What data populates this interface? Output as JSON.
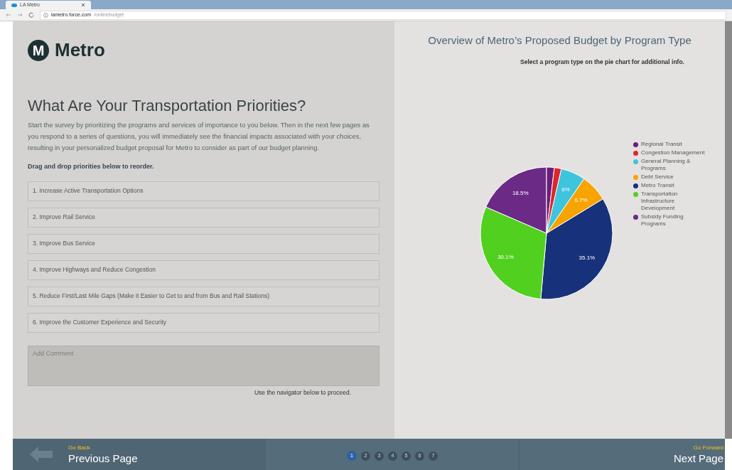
{
  "browser": {
    "tab_title": "LA Metro",
    "url_host": "lametro.force.com",
    "url_path": "/onlinebudget"
  },
  "logo": {
    "text": "Metro",
    "letter": "M"
  },
  "survey": {
    "title": "What Are Your Transportation Priorities?",
    "intro": "Start the survey by prioritizing the programs and services of importance to you below. Then in the next few pages as you respond to a series of questions, you will immediately see the financial impacts associated with your choices, resulting in your personalized budget proposal for Metro to consider as part of our budget planning.",
    "instruction": "Drag and drop priorities below to reorder.",
    "priorities": [
      "1. Increase Active Transportation Options",
      "2. Improve Rail Service",
      "3. Improve Bus Service",
      "4. Improve Highways and Reduce Congestion",
      "5. Reduce First/Last Mile Gaps (Make it Easier to Get to and from Bus and Rail Stations)",
      "6. Improve the Customer Experience and Security"
    ],
    "comment": {
      "placeholder": "Add Comment"
    },
    "navigator_hint": "Use the navigator below to proceed."
  },
  "overview": {
    "title": "Overview of Metro’s Proposed Budget by Program Type",
    "subtitle": "Select a program type on the pie chart for additional info.",
    "chart_data": {
      "type": "pie",
      "categories": [
        "Regional Transit",
        "Congestion Management",
        "General Planning & Programs",
        "Debt Service",
        "Metro Transit",
        "Transportation Infrastructure Development",
        "Subsidy Funding Programs"
      ],
      "series": [
        {
          "values": [
            1.9,
            1.7,
            6,
            6.7,
            35.1,
            30.1,
            18.5
          ]
        }
      ],
      "colors": [
        "#6a1f7a",
        "#e0242a",
        "#3ec4dc",
        "#f7a300",
        "#17317a",
        "#52d020",
        "#6b2a86"
      ],
      "value_labels": [
        null,
        null,
        "6%",
        "6.7%",
        "35.1%",
        "30.1%",
        "18.5%"
      ],
      "legend": "right"
    }
  },
  "footer": {
    "back": {
      "hint": "Go Back",
      "label": "Previous Page"
    },
    "forward": {
      "hint": "Go Forward",
      "label": "Next Page"
    },
    "pages": [
      {
        "label": "1",
        "selected": true
      },
      {
        "label": "2",
        "selected": false
      },
      {
        "label": "3",
        "selected": false
      },
      {
        "label": "4",
        "selected": false
      },
      {
        "label": "5",
        "selected": false
      },
      {
        "label": "6",
        "selected": false
      },
      {
        "label": "7",
        "selected": false
      }
    ]
  }
}
